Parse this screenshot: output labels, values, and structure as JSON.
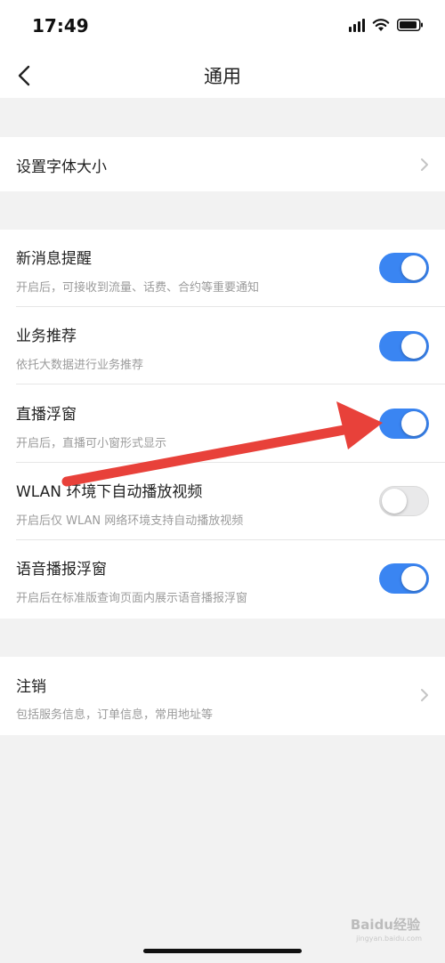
{
  "statusbar": {
    "time": "17:49"
  },
  "nav": {
    "title": "通用"
  },
  "font_size": {
    "label": "设置字体大小"
  },
  "settings": [
    {
      "title": "新消息提醒",
      "subtitle": "开启后，可接收到流量、话费、合约等重要通知",
      "enabled": true
    },
    {
      "title": "业务推荐",
      "subtitle": "依托大数据进行业务推荐",
      "enabled": true
    },
    {
      "title": "直播浮窗",
      "subtitle": "开启后，直播可小窗形式显示",
      "enabled": true
    },
    {
      "title": "WLAN 环境下自动播放视频",
      "subtitle": "开启后仅 WLAN 网络环境支持自动播放视频",
      "enabled": false
    },
    {
      "title": "语音播报浮窗",
      "subtitle": "开启后在标准版查询页面内展示语音播报浮窗",
      "enabled": true
    }
  ],
  "logout": {
    "title": "注销",
    "subtitle": "包括服务信息，订单信息，常用地址等"
  },
  "watermark": {
    "text": "Baidu经验",
    "sub": "jingyan.baidu.com"
  },
  "colors": {
    "accent": "#3a85f2",
    "annotation_arrow": "#e8413a"
  }
}
